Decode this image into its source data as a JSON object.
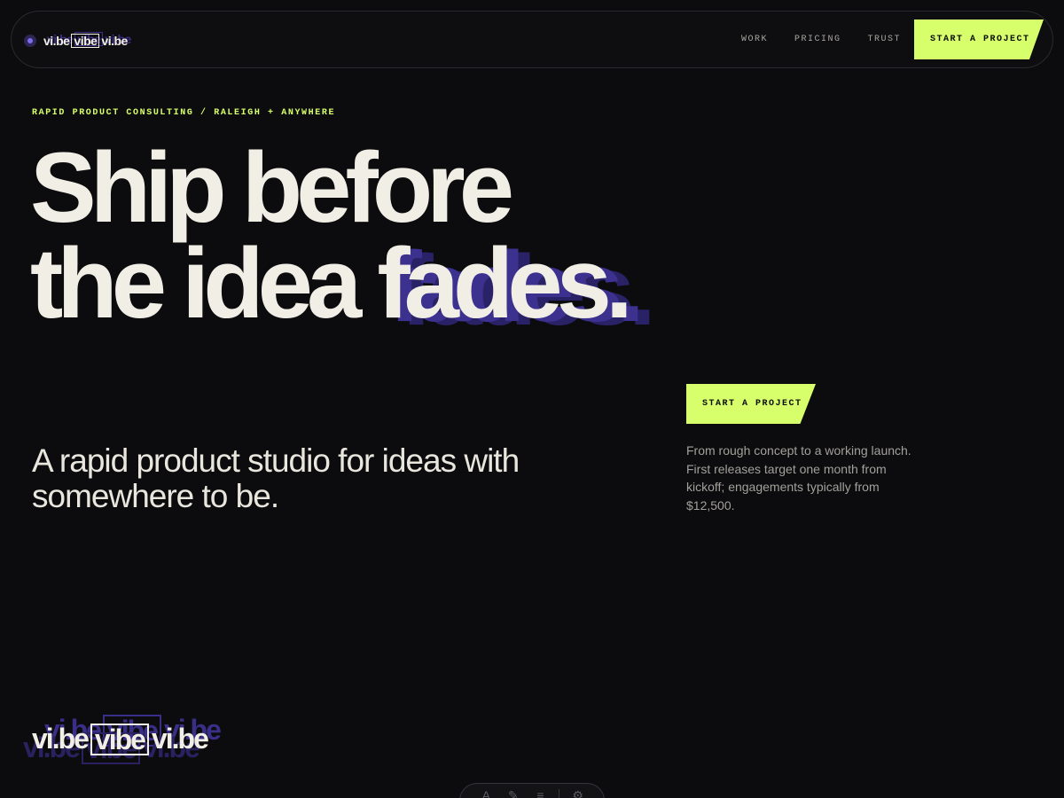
{
  "brand": {
    "parts": [
      "vi.be",
      "vibe",
      "vi.be"
    ]
  },
  "nav": {
    "links": [
      "WORK",
      "PRICING",
      "TRUST"
    ],
    "cta": "START A PROJECT"
  },
  "hero": {
    "eyebrow": "RAPID PRODUCT CONSULTING / RALEIGH + ANYWHERE",
    "headline_line1": "Ship before",
    "headline_line2_a": "the idea ",
    "headline_line2_b": "fades.",
    "cta": "START A PROJECT",
    "subhead": "A rapid product studio for ideas with somewhere to be.",
    "description": "From rough concept to a working launch. First releases target one month from kickoff; engagements typically from $12,500."
  },
  "footer_mark": {
    "parts": [
      "vi.be",
      "vibe",
      "vi.be"
    ]
  },
  "toolbar": {
    "icons": [
      "text-icon",
      "brush-icon",
      "menu-icon",
      "gear-icon"
    ],
    "glyphs": [
      "A",
      "✎",
      "≡",
      "⚙"
    ]
  },
  "colors": {
    "background": "#0c0c0e",
    "accent": "#d7ff6b",
    "purple": "#3a2f87",
    "text": "#f1eee6"
  }
}
